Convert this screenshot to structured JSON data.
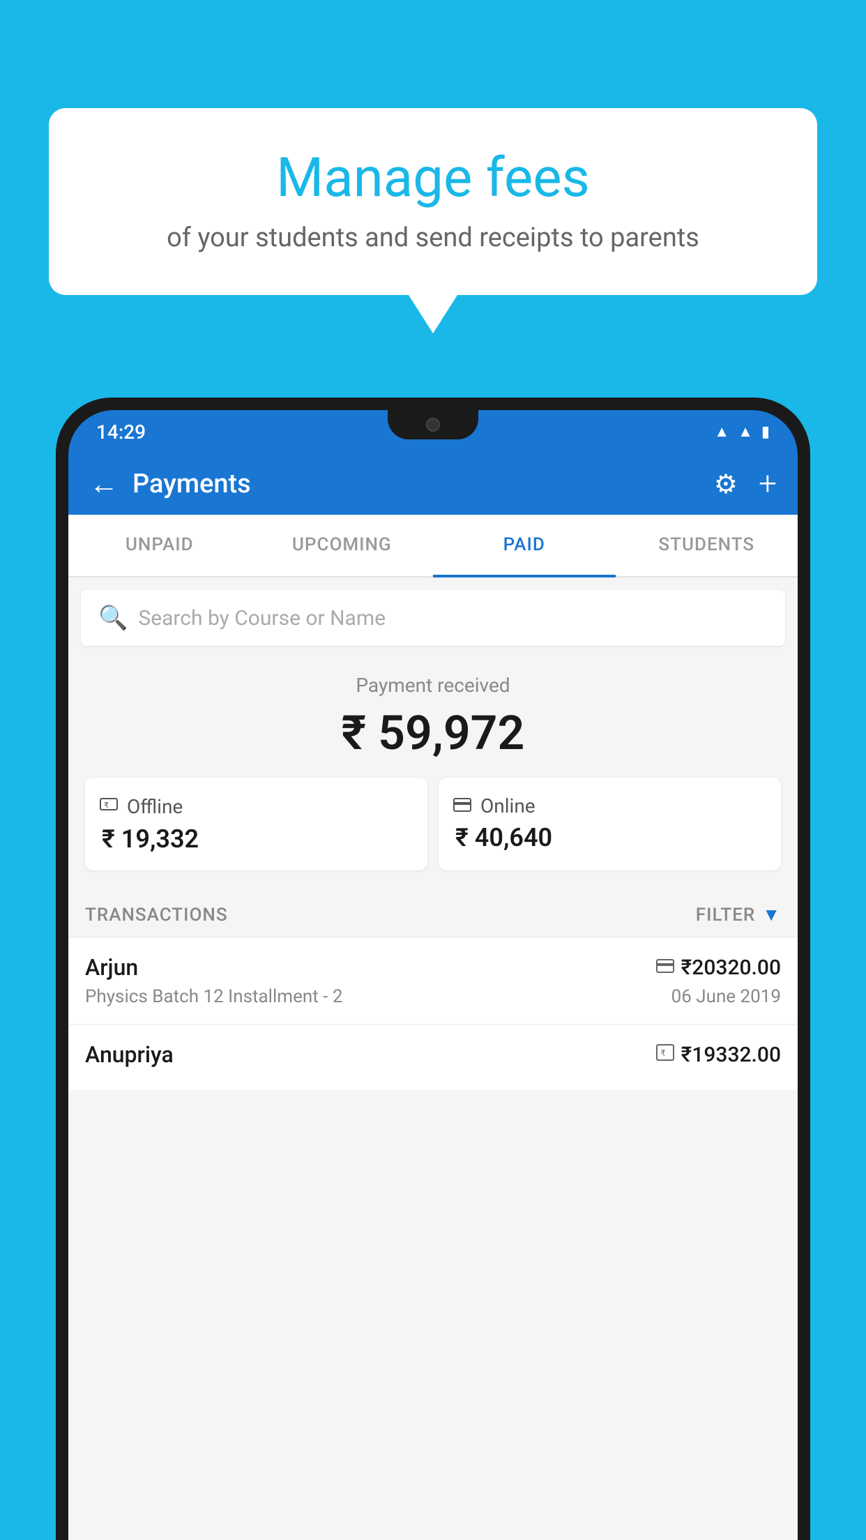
{
  "background_color": "#1ab8e8",
  "speech_bubble": {
    "title": "Manage fees",
    "subtitle": "of your students and send receipts to parents"
  },
  "status_bar": {
    "time": "14:29",
    "icons": [
      "wifi",
      "signal",
      "battery"
    ]
  },
  "app_bar": {
    "title": "Payments",
    "back_label": "←",
    "settings_label": "⚙",
    "add_label": "+"
  },
  "tabs": [
    {
      "label": "UNPAID",
      "active": false
    },
    {
      "label": "UPCOMING",
      "active": false
    },
    {
      "label": "PAID",
      "active": true
    },
    {
      "label": "STUDENTS",
      "active": false
    }
  ],
  "search": {
    "placeholder": "Search by Course or Name"
  },
  "payment_summary": {
    "label": "Payment received",
    "amount": "₹ 59,972",
    "offline": {
      "icon": "💳",
      "label": "Offline",
      "amount": "₹ 19,332"
    },
    "online": {
      "icon": "💳",
      "label": "Online",
      "amount": "₹ 40,640"
    }
  },
  "transactions": {
    "label": "TRANSACTIONS",
    "filter_label": "FILTER",
    "items": [
      {
        "name": "Arjun",
        "description": "Physics Batch 12 Installment - 2",
        "amount": "₹20320.00",
        "date": "06 June 2019",
        "payment_type": "card"
      },
      {
        "name": "Anupriya",
        "description": "",
        "amount": "₹19332.00",
        "date": "",
        "payment_type": "rupee"
      }
    ]
  }
}
